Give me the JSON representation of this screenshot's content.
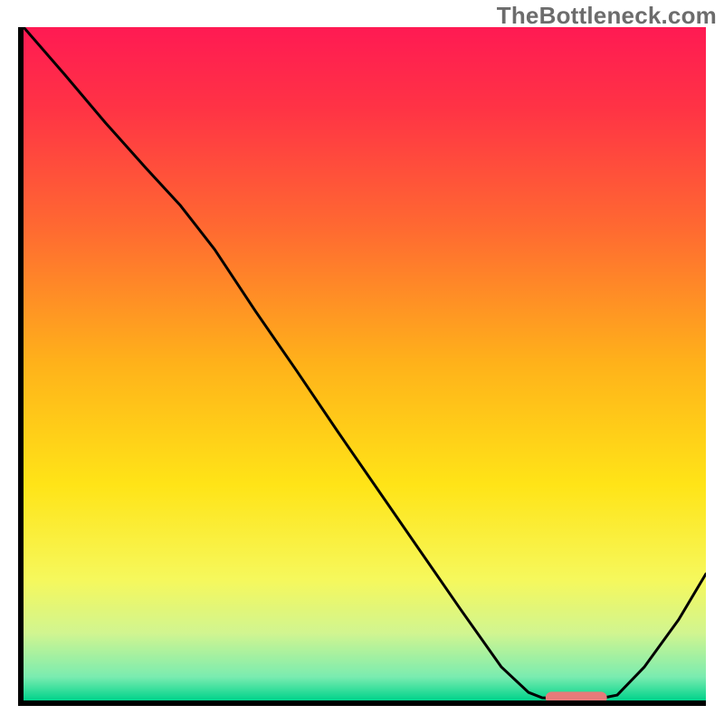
{
  "watermark": "TheBottleneck.com",
  "chart_data": {
    "type": "line",
    "title": "",
    "xlabel": "",
    "ylabel": "",
    "xlim": [
      0,
      1
    ],
    "ylim": [
      0,
      1
    ],
    "legend": false,
    "background_gradient_stops": [
      {
        "offset": 0.0,
        "color": "#ff1a53"
      },
      {
        "offset": 0.12,
        "color": "#ff3345"
      },
      {
        "offset": 0.3,
        "color": "#ff6a31"
      },
      {
        "offset": 0.5,
        "color": "#ffb21a"
      },
      {
        "offset": 0.68,
        "color": "#ffe417"
      },
      {
        "offset": 0.82,
        "color": "#f6f85c"
      },
      {
        "offset": 0.9,
        "color": "#d1f590"
      },
      {
        "offset": 0.965,
        "color": "#7aecb0"
      },
      {
        "offset": 1.0,
        "color": "#00d38b"
      }
    ],
    "series": [
      {
        "name": "curve",
        "stroke": "#000000",
        "stroke_width": 3,
        "x": [
          0.0,
          0.06,
          0.12,
          0.18,
          0.23,
          0.28,
          0.34,
          0.4,
          0.46,
          0.52,
          0.58,
          0.64,
          0.7,
          0.74,
          0.76,
          0.8,
          0.84,
          0.87,
          0.91,
          0.96,
          1.0
        ],
        "y": [
          1.0,
          0.93,
          0.858,
          0.79,
          0.735,
          0.67,
          0.578,
          0.49,
          0.4,
          0.312,
          0.224,
          0.136,
          0.05,
          0.012,
          0.004,
          0.002,
          0.002,
          0.008,
          0.05,
          0.12,
          0.188
        ]
      }
    ],
    "marker": {
      "name": "highlight-range",
      "shape": "rounded-bar",
      "color": "#e67a7a",
      "x_start": 0.765,
      "x_end": 0.855,
      "y": 0.004,
      "thickness": 0.018
    }
  }
}
